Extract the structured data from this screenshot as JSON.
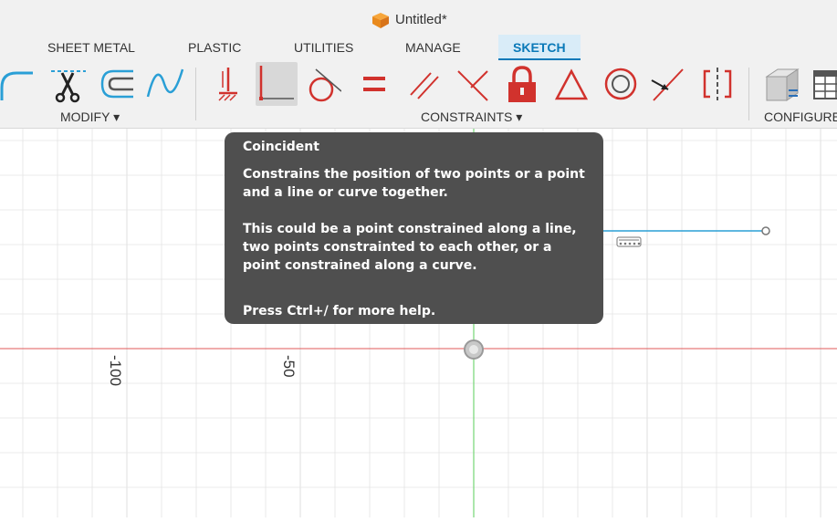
{
  "window": {
    "title": "Untitled*"
  },
  "tabs": [
    {
      "label": "SHEET METAL",
      "active": false
    },
    {
      "label": "PLASTIC",
      "active": false
    },
    {
      "label": "UTILITIES",
      "active": false
    },
    {
      "label": "MANAGE",
      "active": false
    },
    {
      "label": "SKETCH",
      "active": true
    }
  ],
  "ribbon": {
    "groups": {
      "modify": "MODIFY ▾",
      "constraints": "CONSTRAINTS ▾",
      "configure": "CONFIGURE"
    },
    "tools": [
      "fillet-icon",
      "trim-icon",
      "offset-icon",
      "spline-icon",
      "fix-icon",
      "coincident-icon",
      "tangent-icon",
      "equal-icon",
      "parallel-icon",
      "perpendicular-icon",
      "lock-icon",
      "triangle-icon",
      "concentric-icon",
      "midpoint-icon",
      "symmetry-icon",
      "configure-box-icon",
      "table-icon"
    ]
  },
  "canvas": {
    "axis_labels": {
      "minus100": "-100",
      "minus50": "-50"
    },
    "colors": {
      "x_axis": "#e05a5a",
      "y_axis": "#5ed35e",
      "sketch_line": "#2a9fd6",
      "grid": "#e4e4e4"
    }
  },
  "tooltip": {
    "title": "Coincident",
    "p1": "Constrains the position of two points or a point and a line or curve together.",
    "p2": "This could be a point constrained along a line, two points constrainted to each other, or a point constrained along a curve.",
    "p3": "Press Ctrl+/ for more help."
  }
}
